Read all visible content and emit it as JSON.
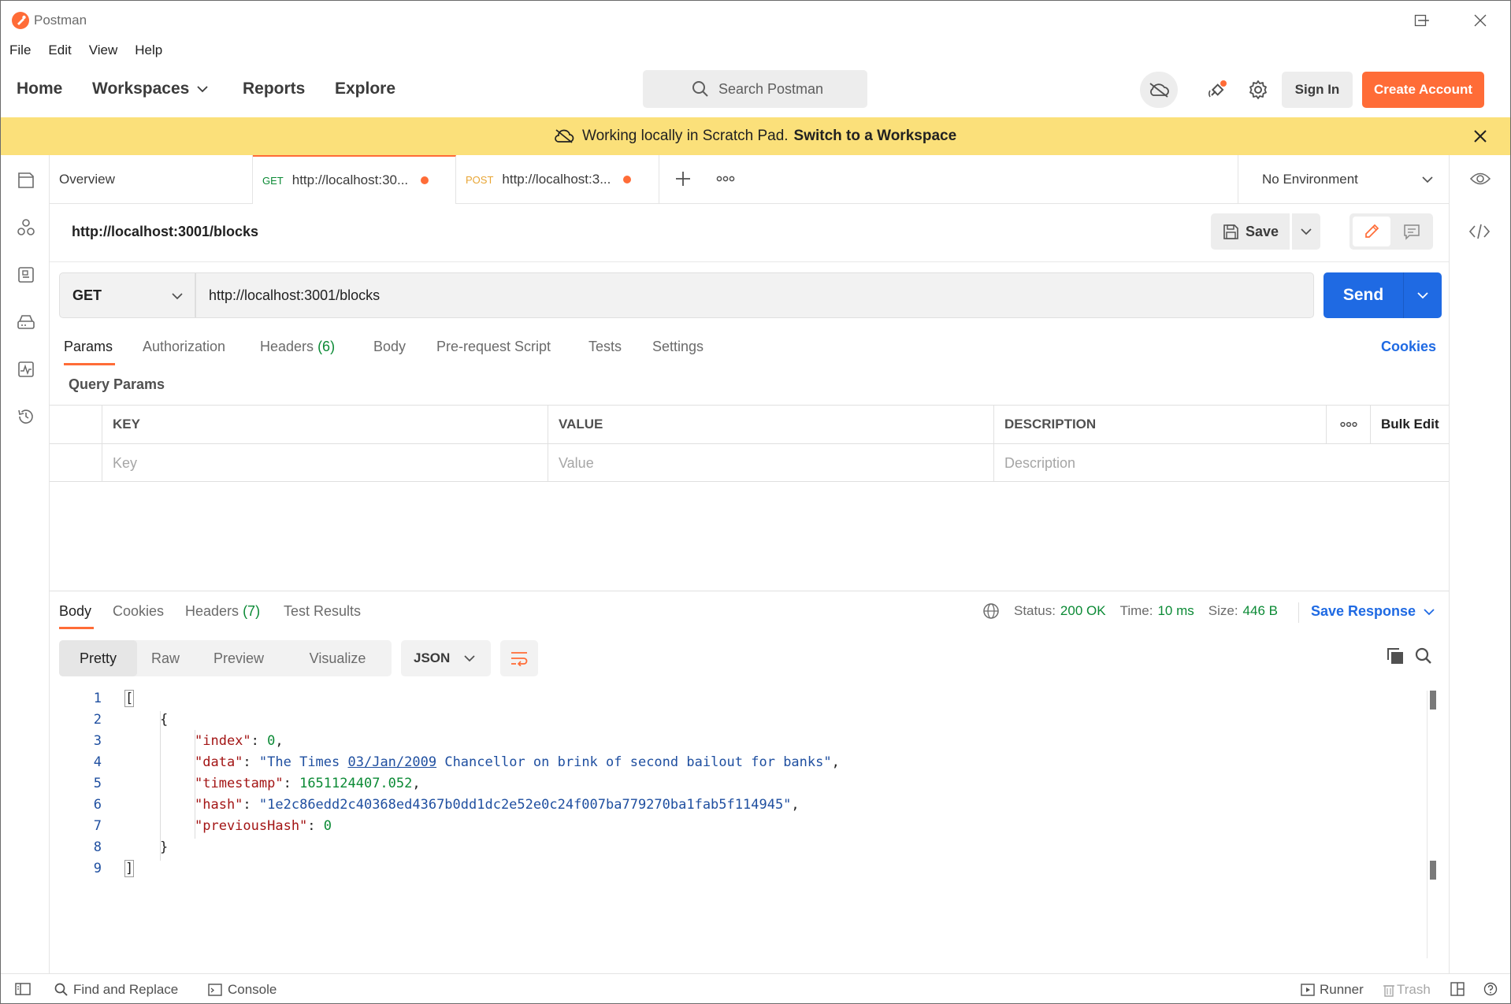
{
  "window": {
    "title": "Postman"
  },
  "menu": [
    "File",
    "Edit",
    "View",
    "Help"
  ],
  "header": {
    "nav": {
      "home": "Home",
      "workspaces": "Workspaces",
      "reports": "Reports",
      "explore": "Explore"
    },
    "search_placeholder": "Search Postman",
    "sign_in": "Sign In",
    "create_account": "Create Account"
  },
  "banner": {
    "text": "Working locally in Scratch Pad.",
    "link": "Switch to a Workspace"
  },
  "tabs": {
    "overview": "Overview",
    "tab1": {
      "method": "GET",
      "label": "http://localhost:30..."
    },
    "tab2": {
      "method": "POST",
      "label": "http://localhost:3..."
    },
    "environment": "No Environment"
  },
  "request": {
    "title": "http://localhost:3001/blocks",
    "save": "Save",
    "method": "GET",
    "url": "http://localhost:3001/blocks",
    "send": "Send",
    "tabs": {
      "params": "Params",
      "authorization": "Authorization",
      "headers": "Headers",
      "headers_count": "(6)",
      "body": "Body",
      "prerequest": "Pre-request Script",
      "tests": "Tests",
      "settings": "Settings"
    },
    "cookies": "Cookies",
    "query_params_label": "Query Params",
    "params_table": {
      "headers": {
        "key": "KEY",
        "value": "VALUE",
        "description": "DESCRIPTION",
        "bulk_edit": "Bulk Edit"
      },
      "placeholders": {
        "key": "Key",
        "value": "Value",
        "description": "Description"
      }
    }
  },
  "response": {
    "tabs": {
      "body": "Body",
      "cookies": "Cookies",
      "headers": "Headers",
      "headers_count": "(7)",
      "test_results": "Test Results"
    },
    "status_label": "Status:",
    "status": "200 OK",
    "time_label": "Time:",
    "time": "10 ms",
    "size_label": "Size:",
    "size": "446 B",
    "save_response": "Save Response",
    "views": {
      "pretty": "Pretty",
      "raw": "Raw",
      "preview": "Preview",
      "visualize": "Visualize"
    },
    "format": "JSON",
    "code": {
      "line_numbers": [
        "1",
        "2",
        "3",
        "4",
        "5",
        "6",
        "7",
        "8",
        "9"
      ],
      "open_bracket": "[",
      "open_brace": "{",
      "k_index": "\"index\"",
      "v_index": "0",
      "k_data": "\"data\"",
      "v_data_1": "\"The Times ",
      "v_data_date": "03/Jan/2009",
      "v_data_2": " Chancellor on brink of second bailout for banks\"",
      "k_timestamp": "\"timestamp\"",
      "v_timestamp": "1651124407.052",
      "k_hash": "\"hash\"",
      "v_hash": "\"1e2c86edd2c40368ed4367b0dd1dc2e52e0c24f007ba779270ba1fab5f114945\"",
      "k_previousHash": "\"previousHash\"",
      "v_previousHash": "0",
      "close_brace": "}",
      "close_bracket": "]"
    }
  },
  "statusbar": {
    "find_replace": "Find and Replace",
    "console": "Console",
    "runner": "Runner",
    "trash": "Trash"
  },
  "colors": {
    "accent": "#ff6c37",
    "primary": "#1f6ae3",
    "banner": "#fbe07a",
    "success": "#0b8a35"
  }
}
